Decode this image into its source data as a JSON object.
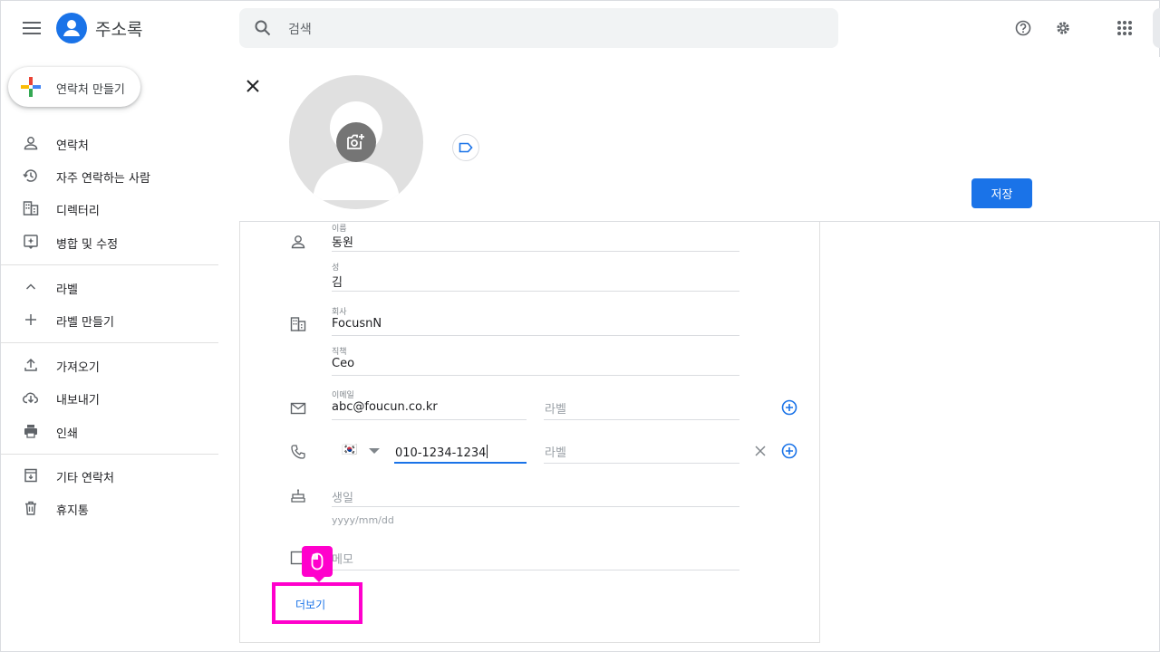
{
  "app": {
    "title": "주소록"
  },
  "search": {
    "placeholder": "검색"
  },
  "sidebar": {
    "create_label": "연락처 만들기",
    "items": [
      {
        "label": "연락처"
      },
      {
        "label": "자주 연락하는 사람"
      },
      {
        "label": "디렉터리"
      },
      {
        "label": "병합 및 수정"
      },
      {
        "label": "라벨"
      },
      {
        "label": "라벨 만들기"
      },
      {
        "label": "가져오기"
      },
      {
        "label": "내보내기"
      },
      {
        "label": "인쇄"
      },
      {
        "label": "기타 연락처"
      },
      {
        "label": "휴지통"
      }
    ]
  },
  "editor": {
    "save_label": "저장",
    "fields": {
      "first_name": {
        "label": "이름",
        "value": "동원"
      },
      "last_name": {
        "label": "성",
        "value": "김"
      },
      "company": {
        "label": "회사",
        "value": "FocusnN"
      },
      "job_title": {
        "label": "직책",
        "value": "Ceo"
      },
      "email": {
        "label": "이메일",
        "value": "abc@foucun.co.kr",
        "label_placeholder": "라벨"
      },
      "phone": {
        "value": "010-1234-1234",
        "label_placeholder": "라벨",
        "country_flag": "🇰🇷"
      },
      "birthday": {
        "placeholder": "생일",
        "hint": "yyyy/mm/dd"
      },
      "notes": {
        "placeholder": "메모"
      }
    },
    "more_label": "더보기"
  },
  "colors": {
    "accent": "#1a73e8",
    "highlight": "#ff00cc",
    "avatar_bg": "#e0e0e0"
  }
}
